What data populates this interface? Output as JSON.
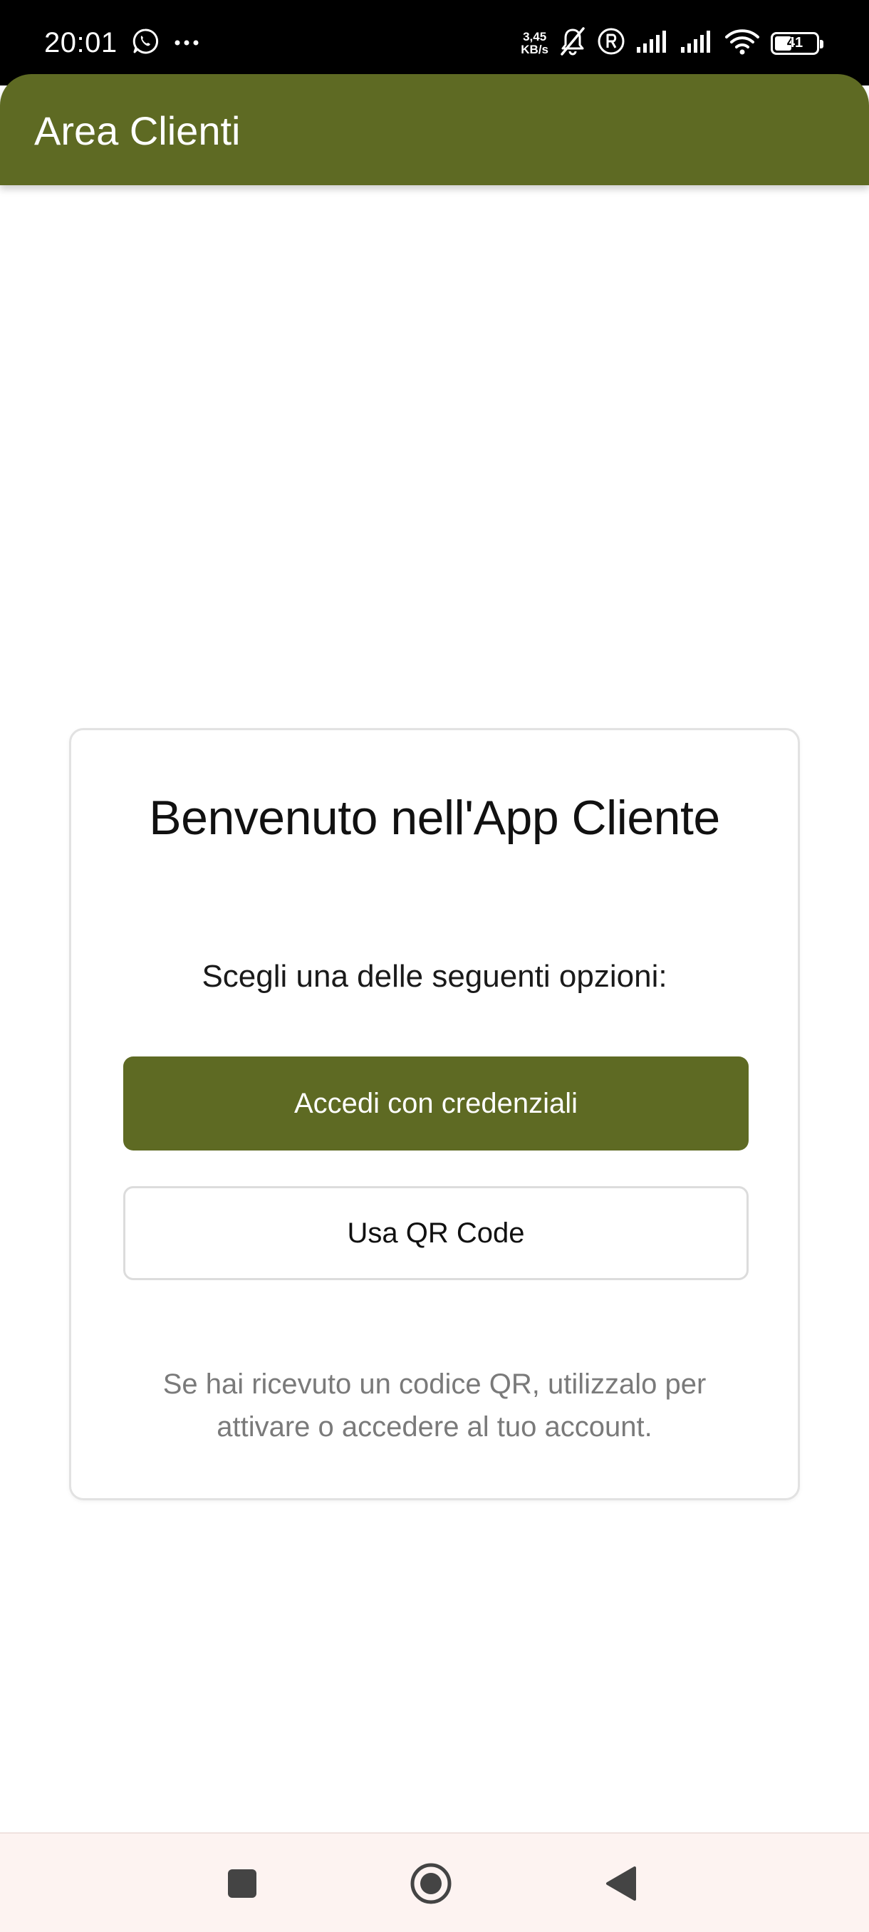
{
  "status_bar": {
    "time": "20:01",
    "network_speed_value": "3,45",
    "network_speed_unit": "KB/s",
    "battery_level": "41",
    "icons": [
      "whatsapp-icon",
      "more-dots-icon",
      "network-speed",
      "mute-bell-icon",
      "roaming-r-icon",
      "signal-icon",
      "signal-icon",
      "wifi-icon",
      "battery-icon"
    ]
  },
  "app_bar": {
    "title": "Area Clienti",
    "color": "#5e6a23"
  },
  "welcome_card": {
    "title": "Benvenuto nell'App Cliente",
    "subtitle": "Scegli una delle seguenti opzioni:",
    "login_button_label": "Accedi con credenziali",
    "qr_button_label": "Usa QR Code",
    "note": "Se hai ricevuto un codice QR, utilizzalo per attivare o accedere al tuo account."
  },
  "nav_bar": {
    "icons": [
      "recents-square-icon",
      "home-circle-icon",
      "back-triangle-icon"
    ]
  }
}
